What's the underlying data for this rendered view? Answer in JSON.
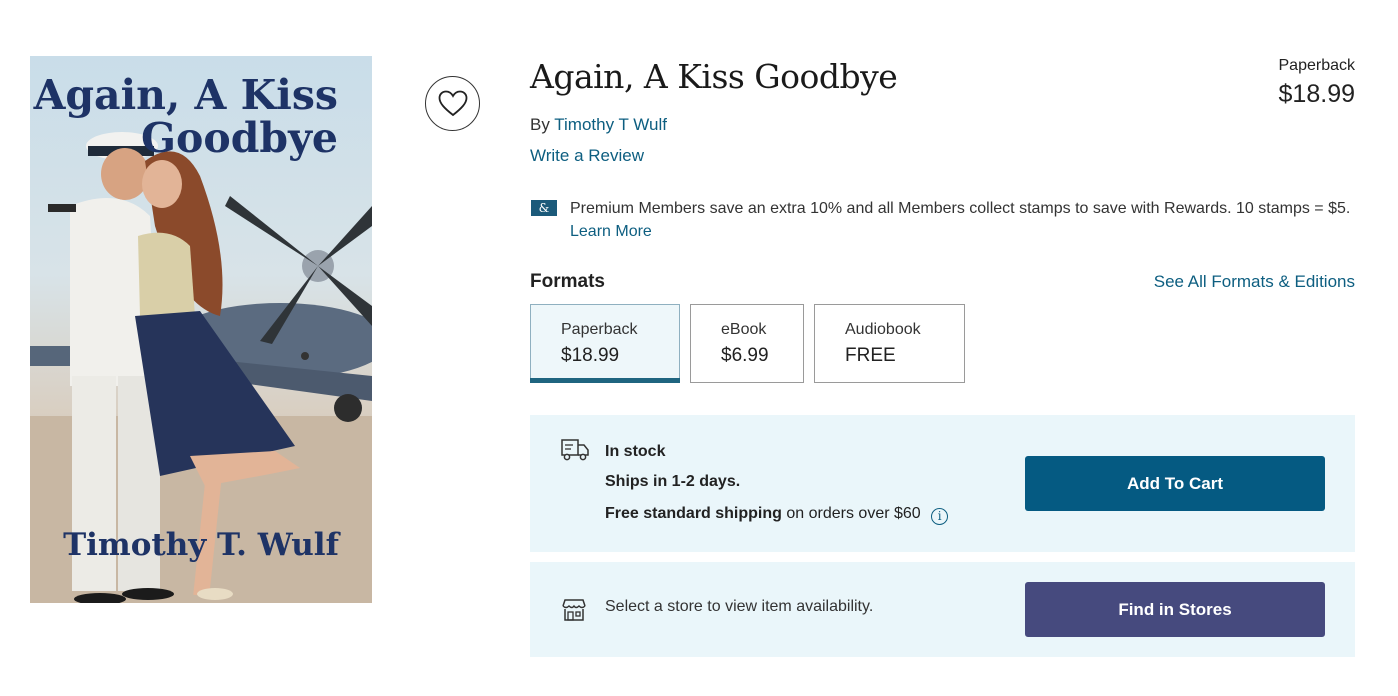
{
  "cover": {
    "title_line1": "Again, A Kiss",
    "title_line2": "Goodbye",
    "author": "Timothy T. Wulf"
  },
  "wishlist": {
    "icon": "heart-icon"
  },
  "product": {
    "title": "Again, A Kiss Goodbye",
    "by_prefix": "By",
    "author": "Timothy T Wulf",
    "write_review": "Write a Review",
    "format_label": "Paperback",
    "price": "$18.99"
  },
  "premium": {
    "badge": "&",
    "text": "Premium Members save an extra 10% and all Members collect stamps to save with Rewards. 10 stamps = $5.",
    "link": "Learn More"
  },
  "formats": {
    "heading": "Formats",
    "see_all": "See All Formats & Editions",
    "items": [
      {
        "name": "Paperback",
        "price": "$18.99",
        "selected": true
      },
      {
        "name": "eBook",
        "price": "$6.99",
        "selected": false
      },
      {
        "name": "Audiobook",
        "price": "FREE",
        "selected": false
      }
    ]
  },
  "shipping": {
    "icon": "truck-icon",
    "stock": "In stock",
    "ships": "Ships in 1-2 days.",
    "free_bold": "Free standard shipping",
    "free_rest": "on orders over $60",
    "info_icon": "info-icon",
    "add_to_cart": "Add To Cart"
  },
  "store": {
    "icon": "store-icon",
    "text": "Select a store to view item availability.",
    "button": "Find in Stores"
  },
  "colors": {
    "link": "#0d5e80",
    "cart_button": "#055a82",
    "store_button": "#464a7e",
    "panel_bg": "#eaf6fa",
    "selected_tab_underline": "#1f6580"
  }
}
